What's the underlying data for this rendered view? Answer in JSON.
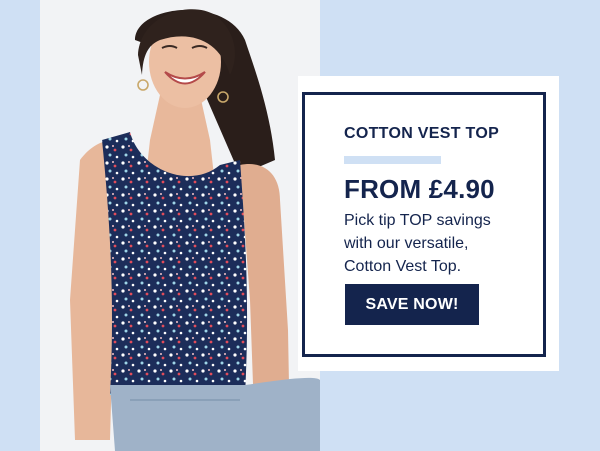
{
  "promo": {
    "eyebrow": "COTTON VEST TOP",
    "price_headline": "FROM £4.90",
    "body_lines": [
      "Pick tip TOP savings",
      "with our versatile,",
      "Cotton Vest Top."
    ],
    "cta_label": "SAVE NOW!"
  },
  "colors": {
    "navy": "#14244d",
    "light_blue": "#cfe0f4",
    "white": "#ffffff"
  }
}
